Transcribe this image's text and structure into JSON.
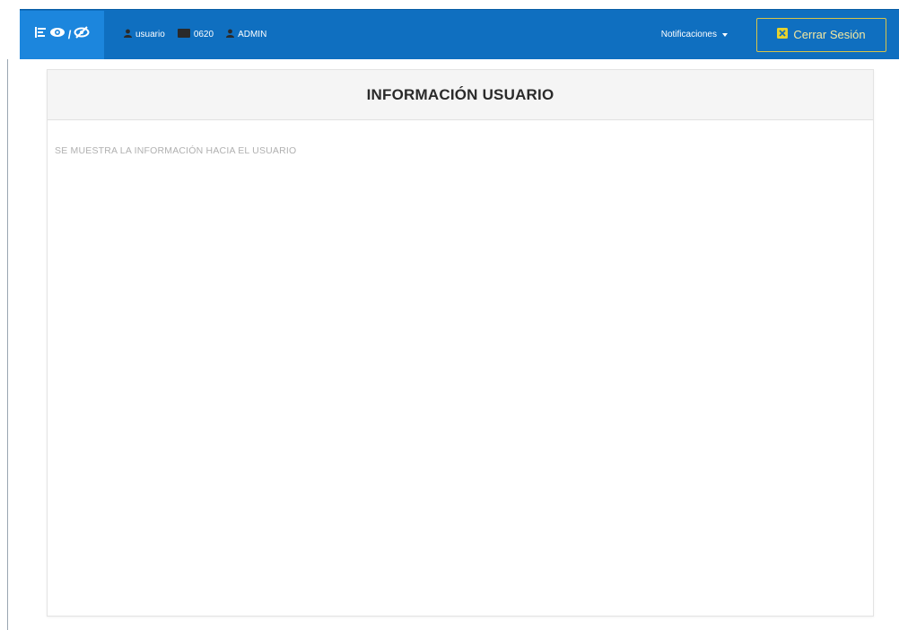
{
  "navbar": {
    "brand": {
      "icons": [
        "menu-icon",
        "eye-icon",
        "eye-slash-icon"
      ],
      "slash": "/"
    },
    "user": {
      "icon": "user-icon",
      "label": "usuario"
    },
    "code": {
      "icon": "id-card-icon",
      "label": "0620"
    },
    "role": {
      "icon": "user-icon",
      "label": "ADMIN"
    },
    "notifications_label": "Notificaciones",
    "logout_label": "Cerrar Sesión",
    "colors": {
      "navbar": "#0f6fc0",
      "brand": "#1c86dd",
      "logout_border": "#d8c44a",
      "logout_icon": "#e6d22e"
    }
  },
  "panel": {
    "title": "INFORMACIÓN USUARIO",
    "description": "SE MUESTRA LA INFORMACIÓN HACIA EL USUARIO"
  }
}
